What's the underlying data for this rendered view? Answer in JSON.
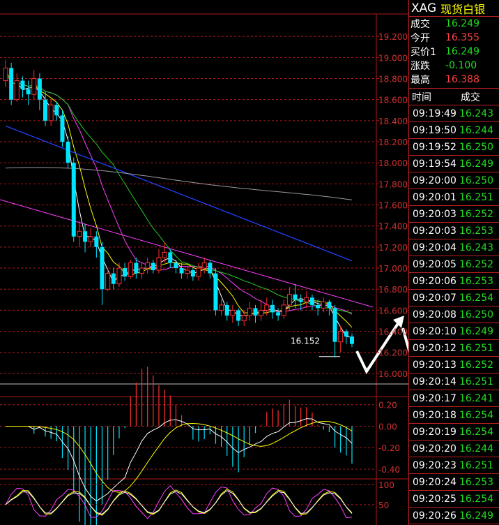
{
  "instrument": {
    "code": "XAG",
    "name": "现货白银"
  },
  "stats": [
    {
      "label": "成交",
      "value": "16.249",
      "color": "green"
    },
    {
      "label": "今开",
      "value": "16.355",
      "color": "red"
    },
    {
      "label": "买价1",
      "value": "16.249",
      "color": "green"
    },
    {
      "label": "涨跌",
      "value": "-0.100",
      "color": "green"
    },
    {
      "label": "最高",
      "value": "16.388",
      "color": "red"
    }
  ],
  "ticks_header": {
    "time": "时间",
    "price": "成交"
  },
  "ticks": [
    {
      "time": "09:19:49",
      "price": "16.243"
    },
    {
      "time": "09:19:50",
      "price": "16.244"
    },
    {
      "time": "09:19:52",
      "price": "16.250"
    },
    {
      "time": "09:19:54",
      "price": "16.249"
    },
    {
      "time": "09:20:00",
      "price": "16.250"
    },
    {
      "time": "09:20:01",
      "price": "16.251"
    },
    {
      "time": "09:20:03",
      "price": "16.252"
    },
    {
      "time": "09:20:03",
      "price": "16.253"
    },
    {
      "time": "09:20:04",
      "price": "16.243"
    },
    {
      "time": "09:20:05",
      "price": "16.252"
    },
    {
      "time": "09:20:06",
      "price": "16.253"
    },
    {
      "time": "09:20:07",
      "price": "16.254"
    },
    {
      "time": "09:20:08",
      "price": "16.250"
    },
    {
      "time": "09:20:10",
      "price": "16.249"
    },
    {
      "time": "09:20:12",
      "price": "16.251"
    },
    {
      "time": "09:20:13",
      "price": "16.252"
    },
    {
      "time": "09:20:14",
      "price": "16.251"
    },
    {
      "time": "09:20:17",
      "price": "16.241"
    },
    {
      "time": "09:20:18",
      "price": "16.254"
    },
    {
      "time": "09:20:19",
      "price": "16.254"
    },
    {
      "time": "09:20:20",
      "price": "16.244"
    },
    {
      "time": "09:20:23",
      "price": "16.251"
    },
    {
      "time": "09:20:24",
      "price": "16.253"
    },
    {
      "time": "09:20:25",
      "price": "16.254"
    },
    {
      "time": "09:20:26",
      "price": "16.249"
    }
  ],
  "colors": {
    "up": "#ff3030",
    "down": "#00e5ff",
    "grid": "#b01818",
    "text_green": "#22dd22"
  },
  "chart_data": {
    "type": "candlestick",
    "price_axis_ticks": [
      "19.200",
      "19.000",
      "18.800",
      "18.600",
      "18.400",
      "18.200",
      "18.000",
      "17.800",
      "17.600",
      "17.400",
      "17.200",
      "17.000",
      "16.800",
      "16.600",
      "16.400",
      "16.200",
      "16.000"
    ],
    "price_ylim": [
      15.9,
      19.4
    ],
    "low_annotation": "16.152",
    "macd_axis_ticks": [
      "0.20",
      "0.00",
      "-0.20",
      "-0.40"
    ],
    "macd_ylim": [
      -0.4,
      0.25
    ],
    "osc_axis_ticks": [
      "100",
      "50"
    ],
    "osc_ylim": [
      0,
      110
    ],
    "candles": [
      [
        18.78,
        18.9,
        18.72,
        18.98
      ],
      [
        18.9,
        18.6,
        18.55,
        18.95
      ],
      [
        18.6,
        18.78,
        18.58,
        18.85
      ],
      [
        18.78,
        18.7,
        18.62,
        18.82
      ],
      [
        18.7,
        18.65,
        18.55,
        18.78
      ],
      [
        18.65,
        18.8,
        18.6,
        18.88
      ],
      [
        18.8,
        18.6,
        18.5,
        18.85
      ],
      [
        18.6,
        18.4,
        18.35,
        18.68
      ],
      [
        18.4,
        18.55,
        18.35,
        18.6
      ],
      [
        18.55,
        18.45,
        18.4,
        18.58
      ],
      [
        18.45,
        18.2,
        18.15,
        18.5
      ],
      [
        18.2,
        18.0,
        17.95,
        18.25
      ],
      [
        18.0,
        17.3,
        17.25,
        18.05
      ],
      [
        17.3,
        17.35,
        17.2,
        17.45
      ],
      [
        17.35,
        17.25,
        17.15,
        17.42
      ],
      [
        17.25,
        17.3,
        17.2,
        17.38
      ],
      [
        17.3,
        17.2,
        17.1,
        17.35
      ],
      [
        17.2,
        16.8,
        16.65,
        17.25
      ],
      [
        16.8,
        16.95,
        16.78,
        17.0
      ],
      [
        16.95,
        16.85,
        16.8,
        17.0
      ],
      [
        16.85,
        17.0,
        16.82,
        17.05
      ],
      [
        17.0,
        16.92,
        16.88,
        17.05
      ],
      [
        16.92,
        17.05,
        16.9,
        17.08
      ],
      [
        17.05,
        16.95,
        16.9,
        17.1
      ],
      [
        16.95,
        17.0,
        16.9,
        17.05
      ],
      [
        17.0,
        17.05,
        16.95,
        17.1
      ],
      [
        17.05,
        16.98,
        16.95,
        17.08
      ],
      [
        16.98,
        17.1,
        16.95,
        17.18
      ],
      [
        17.1,
        17.15,
        17.05,
        17.25
      ],
      [
        17.15,
        17.05,
        17.0,
        17.18
      ],
      [
        17.05,
        17.0,
        16.95,
        17.08
      ],
      [
        17.0,
        16.95,
        16.9,
        17.05
      ],
      [
        16.95,
        16.98,
        16.9,
        17.02
      ],
      [
        16.98,
        16.92,
        16.88,
        17.0
      ],
      [
        16.92,
        17.0,
        16.88,
        17.05
      ],
      [
        17.0,
        17.05,
        16.95,
        17.1
      ],
      [
        17.05,
        16.95,
        16.9,
        17.08
      ],
      [
        16.95,
        16.6,
        16.55,
        17.0
      ],
      [
        16.6,
        16.65,
        16.55,
        16.7
      ],
      [
        16.65,
        16.55,
        16.5,
        16.68
      ],
      [
        16.55,
        16.6,
        16.48,
        16.65
      ],
      [
        16.6,
        16.5,
        16.45,
        16.62
      ],
      [
        16.5,
        16.55,
        16.45,
        16.6
      ],
      [
        16.55,
        16.62,
        16.5,
        16.68
      ],
      [
        16.62,
        16.55,
        16.48,
        16.65
      ],
      [
        16.55,
        16.6,
        16.5,
        16.7
      ],
      [
        16.6,
        16.65,
        16.55,
        16.72
      ],
      [
        16.65,
        16.58,
        16.52,
        16.7
      ],
      [
        16.58,
        16.55,
        16.5,
        16.62
      ],
      [
        16.55,
        16.65,
        16.52,
        16.7
      ],
      [
        16.65,
        16.75,
        16.6,
        16.82
      ],
      [
        16.75,
        16.7,
        16.62,
        16.85
      ],
      [
        16.7,
        16.68,
        16.6,
        16.75
      ],
      [
        16.68,
        16.72,
        16.62,
        16.78
      ],
      [
        16.72,
        16.65,
        16.6,
        16.75
      ],
      [
        16.65,
        16.62,
        16.55,
        16.7
      ],
      [
        16.62,
        16.68,
        16.58,
        16.72
      ],
      [
        16.68,
        16.62,
        16.55,
        16.7
      ],
      [
        16.62,
        16.3,
        16.15,
        16.65
      ],
      [
        16.3,
        16.4,
        16.2,
        16.45
      ],
      [
        16.4,
        16.35,
        16.28,
        16.42
      ],
      [
        16.35,
        16.28,
        16.25,
        16.38
      ]
    ]
  }
}
